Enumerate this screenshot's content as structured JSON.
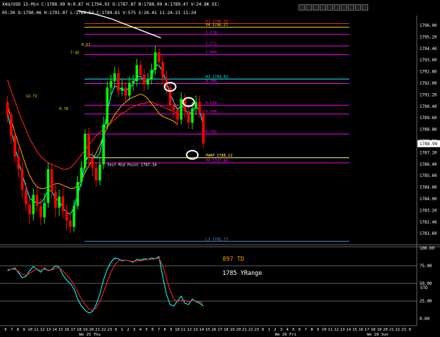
{
  "header": {
    "symbol_line": "XAU/USD  15-Min  C:1788.99  N:0.87  H:1794.93  O:1787.87  B:1788.99  A:1789.47  V:24.8K  OI:",
    "time_line": "05:30  O:1790.06  H:1791.07  L:1789.52  C:1789.61  V:575  S:26.41  11-24-21  11:24"
  },
  "toolbar": {
    "icons": [
      "minimize-icon",
      "restore-icon",
      "help-icon",
      "star-icon",
      "target-icon",
      "zoom-icon",
      "grid-icon",
      "settings-icon",
      "window-icon",
      "close-icon"
    ]
  },
  "colors": {
    "background": "#000000",
    "bull": "#00ff00",
    "bear": "#ff0000",
    "magenta": "#ff00ff",
    "ma_red": "#ff2020",
    "ma_orange": "#ff9900",
    "ma_cyan": "#00ffff",
    "pivot": "#4a8cc8",
    "vwap": "#ffff66",
    "yh": "#e8e400",
    "white": "#ffffff",
    "stoch_k": "#00ffff",
    "stoch_d": "#ff2020"
  },
  "chart_data": [
    {
      "type": "candlestick",
      "title": "",
      "ylim": [
        1783.0,
        1797.0
      ],
      "y_ticks": [
        "1796.00",
        "1795.20",
        "1794.40",
        "1793.60",
        "1792.80",
        "1792.00",
        "1791.20",
        "1790.40",
        "1789.60",
        "1788.80",
        "1788.00",
        "1787.20",
        "1786.40",
        "1785.60",
        "1784.80",
        "1784.00",
        "1783.20",
        "1782.40",
        "1781.60"
      ],
      "current_price_label": "1788.99",
      "x_tick_labels": [
        "6",
        "7",
        "8",
        "9",
        "10",
        "11",
        "12",
        "13",
        "14",
        "15",
        "16",
        "17",
        "18",
        "19",
        "20",
        "21",
        "22",
        "23",
        "0",
        "1",
        "2",
        "3",
        "4",
        "5",
        "6",
        "7",
        "8",
        "9",
        "10",
        "11",
        "12",
        "13",
        "14",
        "15",
        "16",
        "17",
        "18",
        "19",
        "20",
        "21",
        "22",
        "23",
        "0",
        "1",
        "2",
        "3",
        "4",
        "5",
        "6",
        "7",
        "8",
        "9",
        "10",
        "11",
        "12",
        "13",
        "14",
        "15",
        "16",
        "17",
        "18",
        "19",
        "20",
        "21",
        "22",
        "23",
        "0",
        "1"
      ],
      "x_day_labels": [
        {
          "text": "We 25 Thu",
          "at": 12
        },
        {
          "text": "We 26 Fri",
          "at": 44
        },
        {
          "text": "We 28 Sun",
          "at": 59
        }
      ],
      "levels": [
        {
          "label": "R1 1796.38",
          "value": 1796.5,
          "color": "#ff3333"
        },
        {
          "label": "YH 1796.27",
          "value": 1796.27,
          "color": "#e8e400"
        },
        {
          "label": "1.618",
          "value": 1795.82,
          "color": "#ff00ff"
        },
        {
          "label": "1.272",
          "value": 1795.1,
          "color": "#ff00ff"
        },
        {
          "label": "1.000",
          "value": 1794.55,
          "color": "#ff00ff"
        },
        {
          "label": "H3 1793.03",
          "value": 1793.03,
          "color": "#00ffff"
        },
        {
          "label": "0.786",
          "value": 1792.75,
          "color": "#ff00ff"
        },
        {
          "label": "0.618",
          "value": 1791.4,
          "color": "#ff00ff"
        },
        {
          "label": "0.500",
          "value": 1790.85,
          "color": "#ff00ff"
        },
        {
          "label": "0.382",
          "value": 1789.6,
          "color": "#ff00ff"
        },
        {
          "label": "VWAP 1788.12",
          "value": 1788.12,
          "color": "#ffff66"
        },
        {
          "label": "PP 1787.80",
          "value": 1787.8,
          "color": "#ff00ff"
        },
        {
          "label": "L3 1782.73",
          "value": 1782.9,
          "color": "#4a8cc8"
        }
      ],
      "annotations": [
        {
          "text": "0.57",
          "bar": 20,
          "value": 1795.1
        },
        {
          "text": "7.45",
          "bar": 17,
          "value": 1794.6
        },
        {
          "text": "12.72",
          "bar": 5,
          "value": 1791.9
        },
        {
          "text": "0.78",
          "bar": 14,
          "value": 1791.1
        },
        {
          "text": "Yest Mid Point 1787.34",
          "bar": 27,
          "value": 1787.6
        }
      ],
      "candles": [
        [
          1791.6,
          1790.8,
          1792.0,
          1790.3
        ],
        [
          1790.8,
          1789.5,
          1791.0,
          1789.0
        ],
        [
          1789.5,
          1788.2,
          1789.8,
          1787.8
        ],
        [
          1788.2,
          1787.4,
          1788.7,
          1786.9
        ],
        [
          1787.4,
          1786.1,
          1787.9,
          1785.6
        ],
        [
          1786.1,
          1785.2,
          1786.6,
          1784.8
        ],
        [
          1785.2,
          1784.6,
          1785.6,
          1784.0
        ],
        [
          1784.6,
          1785.8,
          1786.2,
          1784.2
        ],
        [
          1785.8,
          1785.1,
          1786.3,
          1784.7
        ],
        [
          1785.1,
          1784.4,
          1785.6,
          1783.9
        ],
        [
          1784.4,
          1785.3,
          1785.9,
          1784.0
        ],
        [
          1785.3,
          1787.4,
          1787.8,
          1785.0
        ],
        [
          1787.4,
          1786.0,
          1787.8,
          1785.6
        ],
        [
          1786.0,
          1785.0,
          1786.5,
          1784.4
        ],
        [
          1785.0,
          1785.7,
          1786.1,
          1784.5
        ],
        [
          1785.7,
          1784.8,
          1786.2,
          1784.3
        ],
        [
          1784.8,
          1784.2,
          1785.2,
          1783.6
        ],
        [
          1784.2,
          1783.8,
          1784.7,
          1783.4
        ],
        [
          1783.8,
          1785.1,
          1785.5,
          1783.5
        ],
        [
          1785.1,
          1786.6,
          1787.0,
          1784.9
        ],
        [
          1786.6,
          1787.5,
          1787.9,
          1786.3
        ],
        [
          1787.5,
          1789.6,
          1789.9,
          1787.2
        ],
        [
          1789.6,
          1788.1,
          1790.0,
          1787.6
        ],
        [
          1788.1,
          1787.5,
          1788.5,
          1787.0
        ],
        [
          1787.5,
          1786.7,
          1787.9,
          1786.3
        ],
        [
          1786.7,
          1787.7,
          1788.2,
          1786.4
        ],
        [
          1787.7,
          1790.2,
          1790.7,
          1787.4
        ],
        [
          1790.2,
          1792.5,
          1792.9,
          1789.9
        ],
        [
          1792.5,
          1792.9,
          1793.3,
          1791.9
        ],
        [
          1792.9,
          1793.4,
          1793.8,
          1792.5
        ],
        [
          1793.4,
          1792.3,
          1793.8,
          1791.9
        ],
        [
          1792.3,
          1792.5,
          1793.0,
          1792.0
        ],
        [
          1792.5,
          1792.0,
          1792.9,
          1791.6
        ],
        [
          1792.0,
          1792.8,
          1793.2,
          1791.7
        ],
        [
          1792.8,
          1792.9,
          1793.3,
          1792.3
        ],
        [
          1792.9,
          1793.9,
          1794.3,
          1792.6
        ],
        [
          1793.9,
          1793.3,
          1794.2,
          1792.9
        ],
        [
          1793.3,
          1792.7,
          1793.7,
          1792.3
        ],
        [
          1792.7,
          1793.0,
          1793.4,
          1792.4
        ],
        [
          1793.0,
          1793.6,
          1794.0,
          1792.7
        ],
        [
          1793.6,
          1794.7,
          1795.1,
          1793.3
        ],
        [
          1794.7,
          1794.1,
          1795.0,
          1793.7
        ],
        [
          1794.1,
          1793.1,
          1794.5,
          1792.7
        ],
        [
          1793.1,
          1792.5,
          1793.6,
          1792.1
        ],
        [
          1792.5,
          1791.4,
          1792.8,
          1791.0
        ],
        [
          1791.4,
          1791.1,
          1791.8,
          1790.6
        ],
        [
          1791.1,
          1790.5,
          1791.5,
          1790.1
        ],
        [
          1790.5,
          1791.8,
          1792.2,
          1790.2
        ],
        [
          1791.8,
          1791.0,
          1792.1,
          1790.6
        ],
        [
          1791.0,
          1790.3,
          1791.4,
          1789.9
        ],
        [
          1790.3,
          1791.2,
          1791.6,
          1789.9
        ],
        [
          1791.2,
          1791.6,
          1792.0,
          1790.8
        ],
        [
          1791.6,
          1790.9,
          1792.0,
          1790.6
        ],
        [
          1790.9,
          1789.0,
          1791.1,
          1788.7
        ]
      ],
      "series": [
        {
          "name": "",
          "color": "#ff2020",
          "values": [
            1793.0,
            1792.3,
            1791.7,
            1791.0,
            1790.4,
            1789.9,
            1789.3,
            1788.9,
            1788.5,
            1788.2,
            1788.0,
            1787.8,
            1787.7,
            1787.6,
            1787.5,
            1787.4,
            1787.4,
            1787.5,
            1787.7,
            1788.0,
            1788.3,
            1788.6,
            1788.9,
            1789.2,
            1789.5,
            1789.7,
            1789.9,
            1790.1,
            1790.3,
            1790.5,
            1790.7,
            1790.9,
            1791.0,
            1791.2,
            1791.3,
            1791.4,
            1791.5,
            1791.5,
            1791.6,
            1791.6,
            1791.5,
            1791.4,
            1791.3,
            1791.2,
            1791.1,
            1791.0,
            1790.9
          ]
        },
        {
          "name": "",
          "color": "#ff9900",
          "values": [
            1791.5,
            1790.5,
            1789.7,
            1789.0,
            1788.3,
            1787.6,
            1787.0,
            1786.6,
            1786.3,
            1786.2,
            1786.2,
            1786.3,
            1786.4,
            1786.5,
            1786.5,
            1786.4,
            1786.3,
            1786.2,
            1786.2,
            1786.4,
            1786.7,
            1787.2,
            1787.6,
            1788.0,
            1788.4,
            1788.9,
            1789.5,
            1790.0,
            1790.4,
            1790.8,
            1791.1,
            1791.4,
            1791.6,
            1791.8,
            1791.9,
            1792.0,
            1792.1,
            1792.0,
            1791.8,
            1791.5,
            1791.2,
            1790.9,
            1790.7,
            1790.6,
            1790.5,
            1790.4,
            1790.2
          ]
        },
        {
          "name": "",
          "color": "#00ffff",
          "values": [
            1790.9,
            1789.9,
            1788.8,
            1787.9,
            1787.1,
            1786.3,
            1785.6,
            1785.4,
            1785.3,
            1785.3,
            1785.6,
            1786.1,
            1786.0,
            1785.6,
            1785.4,
            1785.0,
            1784.7,
            1784.6,
            1785.0,
            1785.8,
            1786.6,
            1787.8,
            1788.3,
            1788.3,
            1788.1,
            1788.4,
            1789.6,
            1791.0,
            1792.0,
            1792.6,
            1792.5,
            1792.4,
            1792.3,
            1792.5,
            1792.7,
            1793.2,
            1793.2,
            1792.9,
            1792.9,
            1793.2,
            1793.9,
            1793.9,
            1793.5,
            1792.9,
            1792.1,
            1791.6,
            1791.1,
            1791.4,
            1791.2,
            1790.8,
            1791.0,
            1791.3,
            1791.1,
            1790.1
          ]
        },
        {
          "name": "",
          "color": "#ffffff",
          "values": [
            1797.3,
            1797.1,
            1796.8,
            1796.4,
            1796.0,
            1795.6
          ]
        }
      ],
      "white_line_start": 19,
      "circles": [
        {
          "bar": 44,
          "value": 1792.55
        },
        {
          "bar": 49,
          "value": 1791.6
        },
        {
          "bar": 50,
          "value": 1788.3
        }
      ]
    },
    {
      "type": "line",
      "title": "",
      "ylim": [
        0,
        100
      ],
      "y_ticks": [
        "100.00",
        "75.00",
        "50.00",
        "25.00",
        "0.00"
      ],
      "indicator_label": "STO",
      "text_overlays": [
        {
          "text": "897 TD",
          "color": "#ff9900"
        },
        {
          "text": "1785 YRange",
          "color": "#ffffff"
        }
      ],
      "series": [
        {
          "name": "",
          "color": "#00ffff",
          "values": [
            68,
            70,
            72,
            65,
            58,
            60,
            68,
            74,
            70,
            66,
            72,
            68,
            70,
            75,
            73,
            62,
            55,
            50,
            42,
            28,
            18,
            12,
            8,
            10,
            20,
            35,
            55,
            70,
            80,
            86,
            85,
            82,
            83,
            82,
            80,
            84,
            83,
            85,
            84,
            86,
            85,
            88,
            60,
            35,
            20,
            18,
            25,
            32,
            22,
            20,
            28,
            24,
            22,
            18
          ]
        },
        {
          "name": "",
          "color": "#ff2020",
          "values": [
            70,
            70,
            70,
            67,
            63,
            62,
            64,
            68,
            70,
            69,
            70,
            69,
            69,
            71,
            72,
            68,
            62,
            56,
            48,
            38,
            28,
            20,
            14,
            12,
            15,
            24,
            38,
            52,
            66,
            76,
            82,
            83,
            83,
            82,
            81,
            82,
            82,
            83,
            84,
            84,
            85,
            86,
            75,
            58,
            40,
            28,
            24,
            26,
            26,
            24,
            25,
            25,
            24,
            22
          ]
        }
      ]
    }
  ]
}
